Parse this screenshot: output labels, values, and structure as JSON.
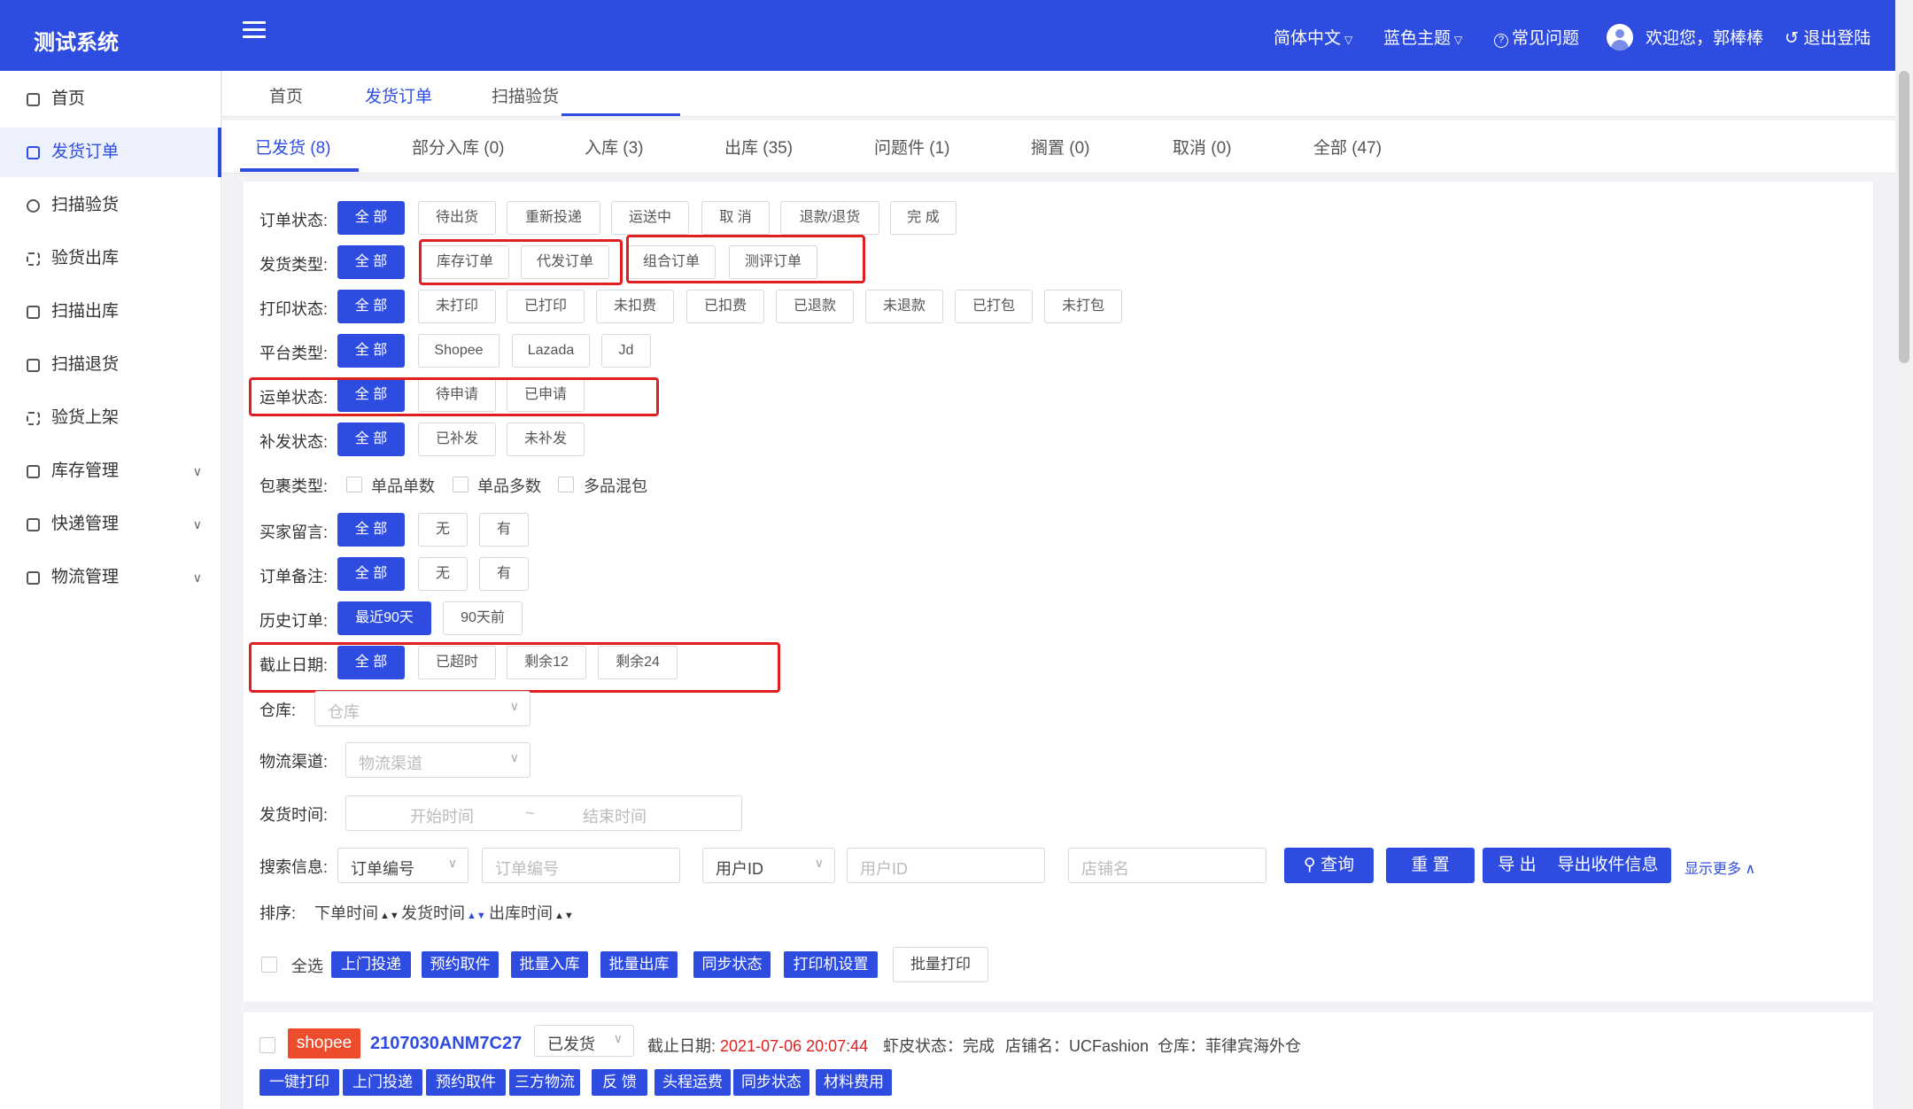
{
  "header": {
    "logo": "测试系统",
    "language": "简体中文",
    "theme": "蓝色主题",
    "faq": "常见问题",
    "welcome": "欢迎您，郭棒棒",
    "logout": "退出登陆"
  },
  "sidebar": {
    "items": [
      {
        "label": "首页",
        "icon": "home-icon"
      },
      {
        "label": "发货订单",
        "icon": "bag-icon",
        "active": true
      },
      {
        "label": "扫描验货",
        "icon": "shield-icon"
      },
      {
        "label": "验货出库",
        "icon": "scan-icon"
      },
      {
        "label": "扫描出库",
        "icon": "truck-icon"
      },
      {
        "label": "扫描退货",
        "icon": "return-icon"
      },
      {
        "label": "验货上架",
        "icon": "scan-icon"
      },
      {
        "label": "库存管理",
        "icon": "grid-icon",
        "expandable": true
      },
      {
        "label": "快递管理",
        "icon": "list-icon",
        "expandable": true
      },
      {
        "label": "物流管理",
        "icon": "truck-icon",
        "expandable": true
      }
    ]
  },
  "top_tabs": [
    "首页",
    "发货订单",
    "扫描验货"
  ],
  "status_tabs": [
    "已发货 (8)",
    "部分入库 (0)",
    "入库 (3)",
    "出库 (35)",
    "问题件 (1)",
    "搁置 (0)",
    "取消 (0)",
    "全部 (47)"
  ],
  "filters": {
    "order_status": {
      "label": "订单状态:",
      "options": [
        "全 部",
        "待出货",
        "重新投递",
        "运送中",
        "取 消",
        "退款/退货",
        "完 成"
      ]
    },
    "ship_type": {
      "label": "发货类型:",
      "options": [
        "全 部",
        "库存订单",
        "代发订单",
        "组合订单",
        "测评订单"
      ]
    },
    "print_status": {
      "label": "打印状态:",
      "options": [
        "全 部",
        "未打印",
        "已打印",
        "未扣费",
        "已扣费",
        "已退款",
        "未退款",
        "已打包",
        "未打包"
      ]
    },
    "platform": {
      "label": "平台类型:",
      "options": [
        "全 部",
        "Shopee",
        "Lazada",
        "Jd"
      ]
    },
    "waybill_status": {
      "label": "运单状态:",
      "options": [
        "全 部",
        "待申请",
        "已申请"
      ]
    },
    "reship_status": {
      "label": "补发状态:",
      "options": [
        "全 部",
        "已补发",
        "未补发"
      ]
    },
    "package_type": {
      "label": "包裹类型:",
      "options": [
        "单品单数",
        "单品多数",
        "多品混包"
      ]
    },
    "buyer_message": {
      "label": "买家留言:",
      "options": [
        "全 部",
        "无",
        "有"
      ]
    },
    "order_note": {
      "label": "订单备注:",
      "options": [
        "全 部",
        "无",
        "有"
      ]
    },
    "history": {
      "label": "历史订单:",
      "options": [
        "最近90天",
        "90天前"
      ]
    },
    "deadline": {
      "label": "截止日期:",
      "options": [
        "全 部",
        "已超时",
        "剩余12",
        "剩余24"
      ]
    },
    "warehouse": {
      "label": "仓库:",
      "placeholder": "仓库"
    },
    "channel": {
      "label": "物流渠道:",
      "placeholder": "物流渠道"
    },
    "ship_time": {
      "label": "发货时间:",
      "start": "开始时间",
      "sep": "~",
      "end": "结束时间"
    },
    "search": {
      "label": "搜索信息:",
      "type_value": "订单编号",
      "order_placeholder": "订单编号",
      "user_type_value": "用户ID",
      "user_placeholder": "用户ID",
      "shop_placeholder": "店铺名",
      "query": "查询",
      "reset": "重 置",
      "export": "导 出",
      "export_receiver": "导出收件信息",
      "more": "显示更多"
    },
    "sort": {
      "label": "排序:",
      "options": [
        "下单时间",
        "发货时间",
        "出库时间"
      ]
    }
  },
  "actions": {
    "select_all": "全选",
    "buttons": [
      "上门投递",
      "预约取件",
      "批量入库",
      "批量出库",
      "同步状态",
      "打印机设置"
    ],
    "batch_print": "批量打印"
  },
  "order": {
    "platform": "shopee",
    "order_no": "2107030ANM7C27",
    "status": "已发货",
    "deadline_label": "截止日期:",
    "deadline_value": "2021-07-06 20:07:44",
    "shopee_status": "虾皮状态：完成",
    "shop": "店铺名：UCFashion",
    "warehouse": "仓库：菲律宾海外仓",
    "buttons": [
      "一键打印",
      "上门投递",
      "预约取件",
      "三方物流",
      "反 馈",
      "头程运费",
      "同步状态",
      "材料费用"
    ]
  },
  "colors": {
    "primary": "#2e4de0",
    "highlight_box": "#e02020",
    "shopee": "#ee4d2d"
  }
}
